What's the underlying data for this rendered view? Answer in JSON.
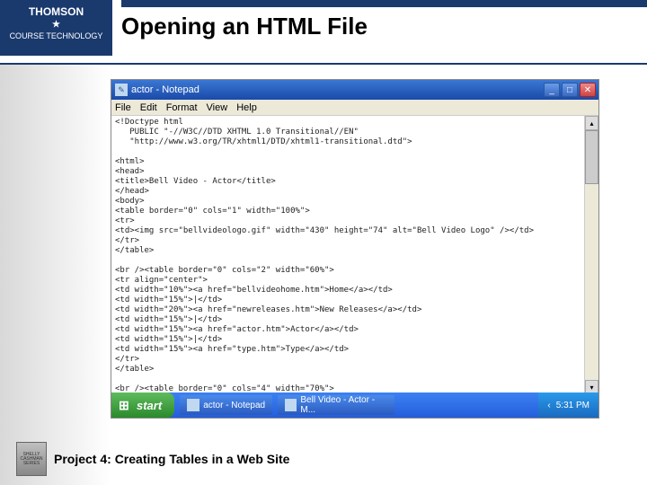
{
  "brand": {
    "name": "THOMSON",
    "sub": "COURSE TECHNOLOGY"
  },
  "slide": {
    "title": "Opening an HTML File"
  },
  "window": {
    "title": "actor - Notepad",
    "menus": [
      "File",
      "Edit",
      "Format",
      "View",
      "Help"
    ]
  },
  "code": "<!Doctype html\n   PUBLIC \"-//W3C//DTD XHTML 1.0 Transitional//EN\"\n   \"http://www.w3.org/TR/xhtml1/DTD/xhtml1-transitional.dtd\">\n\n<html>\n<head>\n<title>Bell Video - Actor</title>\n</head>\n<body>\n<table border=\"0\" cols=\"1\" width=\"100%\">\n<tr>\n<td><img src=\"bellvideologo.gif\" width=\"430\" height=\"74\" alt=\"Bell Video Logo\" /></td>\n</tr>\n</table>\n\n<br /><table border=\"0\" cols=\"2\" width=\"60%\">\n<tr align=\"center\">\n<td width=\"10%\"><a href=\"bellvideohome.htm\">Home</a></td>\n<td width=\"15%\">|</td>\n<td width=\"20%\"><a href=\"newreleases.htm\">New Releases</a></td>\n<td width=\"15%\">|</td>\n<td width=\"15%\"><a href=\"actor.htm\">Actor</a></td>\n<td width=\"15%\">|</td>\n<td width=\"15%\"><a href=\"type.htm\">Type</a></td>\n</tr>\n</table>\n\n<br /><table border=\"0\" cols=\"4\" width=\"70%\">\n<tr bgcolor=\"blue\">\n<th><font color=\"white\" size=\"+1\">Actor</font></th>\n<th><font color=\"white\" size=\"+1\">Movie</font></th>\n<th><font color=\"white\" size=\"+1\">Type</font></th>\n</tr>\n\n<tr>\n<td>Paul Giamatti</td>\n<td>Cinderella Man</td>\n<td>Drama</td>",
  "taskbar": {
    "start": "start",
    "items": [
      "actor - Notepad",
      "Bell Video - Actor - M..."
    ],
    "time": "5:31 PM"
  },
  "footer": {
    "badge": "SHELLY CASHMAN SERIES",
    "text": "Project 4: Creating Tables in a Web Site"
  }
}
